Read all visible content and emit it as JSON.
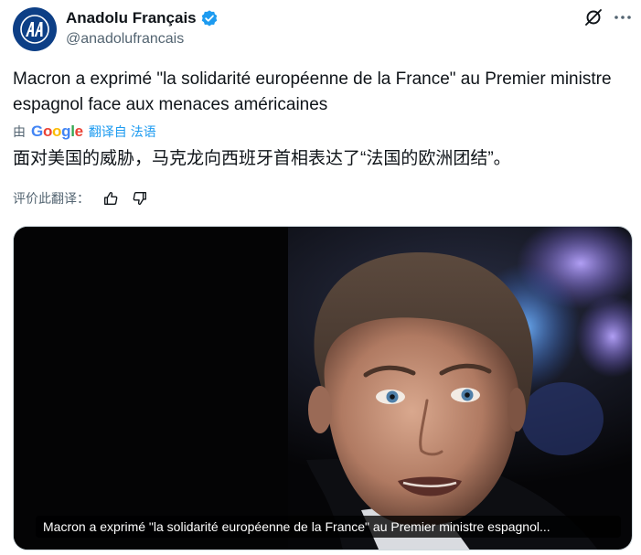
{
  "author": {
    "name": "Anadolu Français",
    "handle": "@anadolufrancais",
    "avatar_text": "AA",
    "verified_color": "#1d9bf0",
    "avatar_color": "#0d3f86"
  },
  "header_icons": [
    "grok-icon",
    "more-icon"
  ],
  "post": {
    "text": "Macron a exprimé \"la solidarité européenne de la France\" au Premier ministre espagnol face aux menaces américaines"
  },
  "translation": {
    "by_label": "由",
    "google_letters": [
      "G",
      "o",
      "o",
      "g",
      "l",
      "e"
    ],
    "link_label": "翻译自 法语",
    "text": "面对美国的威胁，马克龙向西班牙首相表达了“法国的欧洲团结”。",
    "rate_label": "评价此翻译："
  },
  "media": {
    "caption": "Macron a exprimé \"la solidarité européenne de la France\" au Premier ministre espagnol..."
  },
  "colors": {
    "accent": "#1d9bf0",
    "secondary_text": "#536471",
    "primary_text": "#0f1419"
  }
}
